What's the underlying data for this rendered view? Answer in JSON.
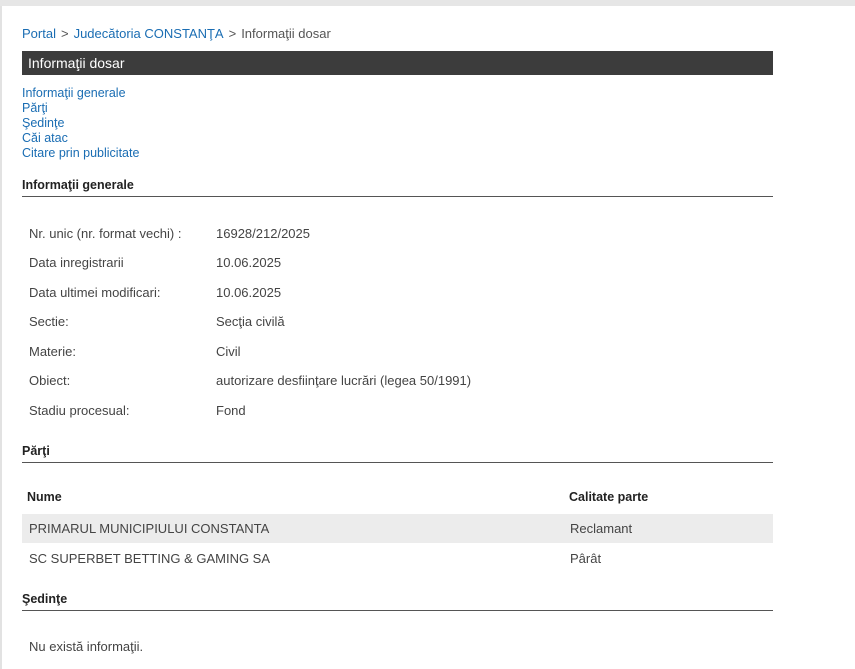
{
  "breadcrumb": {
    "portal": "Portal",
    "court": "Judecătoria CONSTANŢA",
    "current": "Informaţii dosar",
    "separator": ">"
  },
  "section_title": "Informaţii dosar",
  "toc": [
    "Informaţii generale",
    "Părţi",
    "Şedinţe",
    "Căi atac",
    "Citare prin publicitate"
  ],
  "general": {
    "heading": "Informaţii generale",
    "rows": [
      {
        "label": "Nr. unic (nr. format vechi) :",
        "value": "16928/212/2025"
      },
      {
        "label": "Data inregistrarii",
        "value": "10.06.2025"
      },
      {
        "label": "Data ultimei modificari:",
        "value": "10.06.2025"
      },
      {
        "label": "Sectie:",
        "value": "Secţia civilă"
      },
      {
        "label": "Materie:",
        "value": "Civil"
      },
      {
        "label": "Obiect:",
        "value": "autorizare desfiinţare lucrări (legea 50/1991)"
      },
      {
        "label": "Stadiu procesual:",
        "value": "Fond"
      }
    ]
  },
  "parties": {
    "heading": "Părţi",
    "col_name": "Nume",
    "col_role": "Calitate parte",
    "rows": [
      {
        "name": "PRIMARUL MUNICIPIULUI CONSTANTA",
        "role": "Reclamant"
      },
      {
        "name": "SC SUPERBET BETTING & GAMING SA",
        "role": "Pârât"
      }
    ]
  },
  "hearings": {
    "heading": "Şedinţe",
    "empty_text": "Nu există informaţii."
  }
}
